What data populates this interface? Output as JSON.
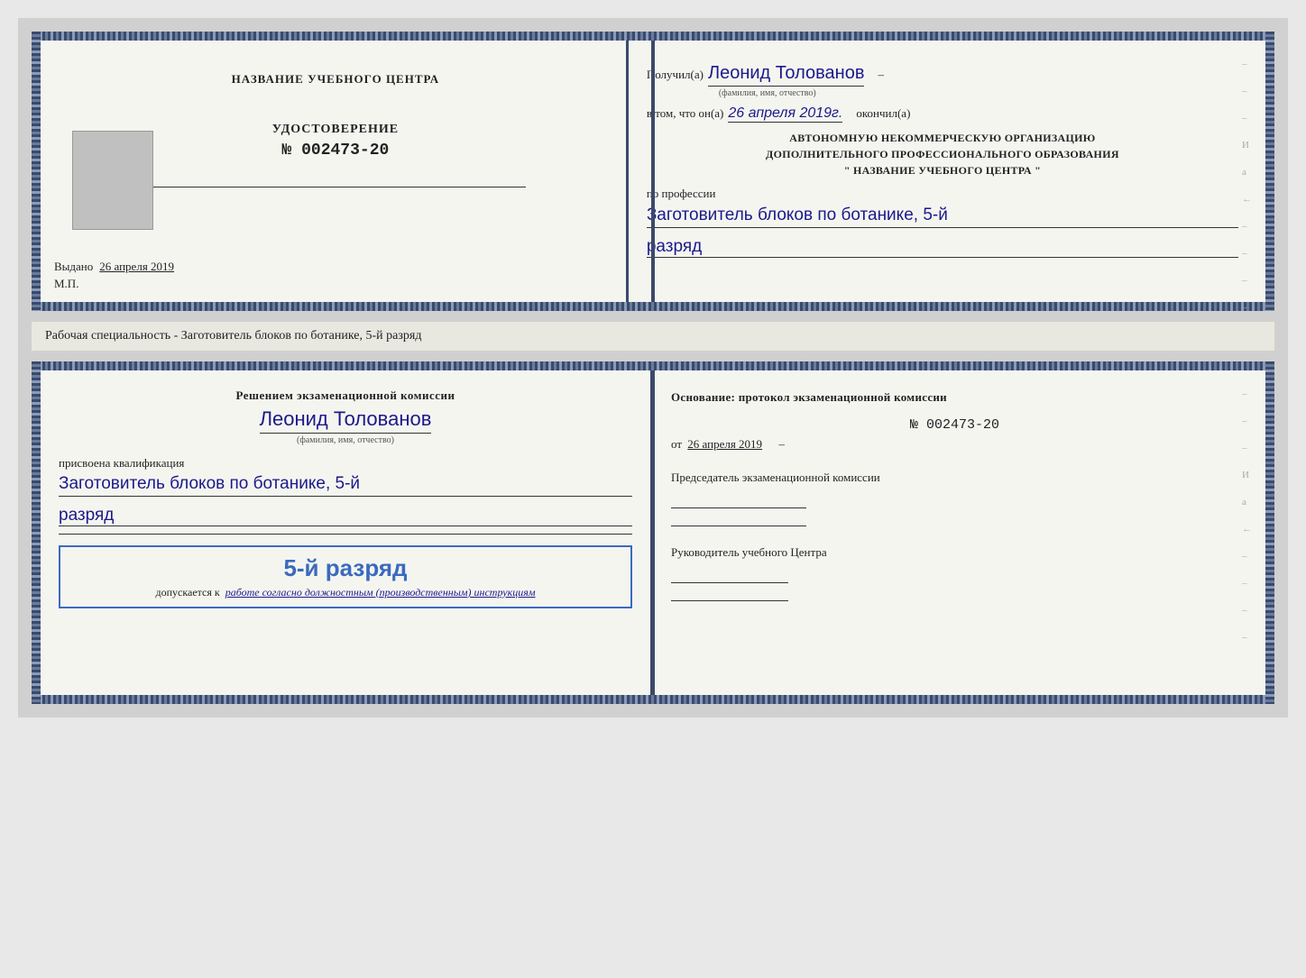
{
  "page": {
    "background": "#d0d0d0"
  },
  "doc1": {
    "left": {
      "center_title": "НАЗВАНИЕ УЧЕБНОГО ЦЕНТРА",
      "cert_label": "УДОСТОВЕРЕНИЕ",
      "cert_number": "№ 002473-20",
      "issued_prefix": "Выдано",
      "issued_date": "26 апреля 2019",
      "mp_label": "М.П."
    },
    "right": {
      "received_prefix": "Получил(а)",
      "recipient_name": "Леонид Толованов",
      "fio_label": "(фамилия, имя, отчество)",
      "confirm_prefix": "в том, что он(а)",
      "confirm_date": "26 апреля 2019г.",
      "confirm_suffix": "окончил(а)",
      "org_line1": "АВТОНОМНУЮ НЕКОММЕРЧЕСКУЮ ОРГАНИЗАЦИЮ",
      "org_line2": "ДОПОЛНИТЕЛЬНОГО ПРОФЕССИОНАЛЬНОГО ОБРАЗОВАНИЯ",
      "org_name": "\"  НАЗВАНИЕ УЧЕБНОГО ЦЕНТРА  \"",
      "profession_prefix": "по профессии",
      "profession_name": "Заготовитель блоков по ботанике, 5-й",
      "rank": "разряд"
    }
  },
  "middle_text": "Рабочая специальность - Заготовитель блоков по ботанике, 5-й разряд",
  "doc2": {
    "left": {
      "decision_text": "Решением экзаменационной комиссии",
      "person_name": "Леонид Толованов",
      "fio_label": "(фамилия, имя, отчество)",
      "assigned_text": "присвоена квалификация",
      "qualification": "Заготовитель блоков по ботанике, 5-й",
      "rank": "разряд",
      "stamp_rank": "5-й разряд",
      "stamp_prefix": "допускается к",
      "stamp_italic": "работе согласно должностным (производственным) инструкциям"
    },
    "right": {
      "basis_text": "Основание: протокол экзаменационной комиссии",
      "protocol_number": "№  002473-20",
      "from_prefix": "от",
      "from_date": "26 апреля 2019",
      "chairman_title": "Председатель экзаменационной комиссии",
      "head_title": "Руководитель учебного Центра"
    }
  },
  "right_marks": [
    "-",
    "-",
    "-",
    "И",
    "а",
    "←",
    "-",
    "-",
    "-",
    "-"
  ]
}
